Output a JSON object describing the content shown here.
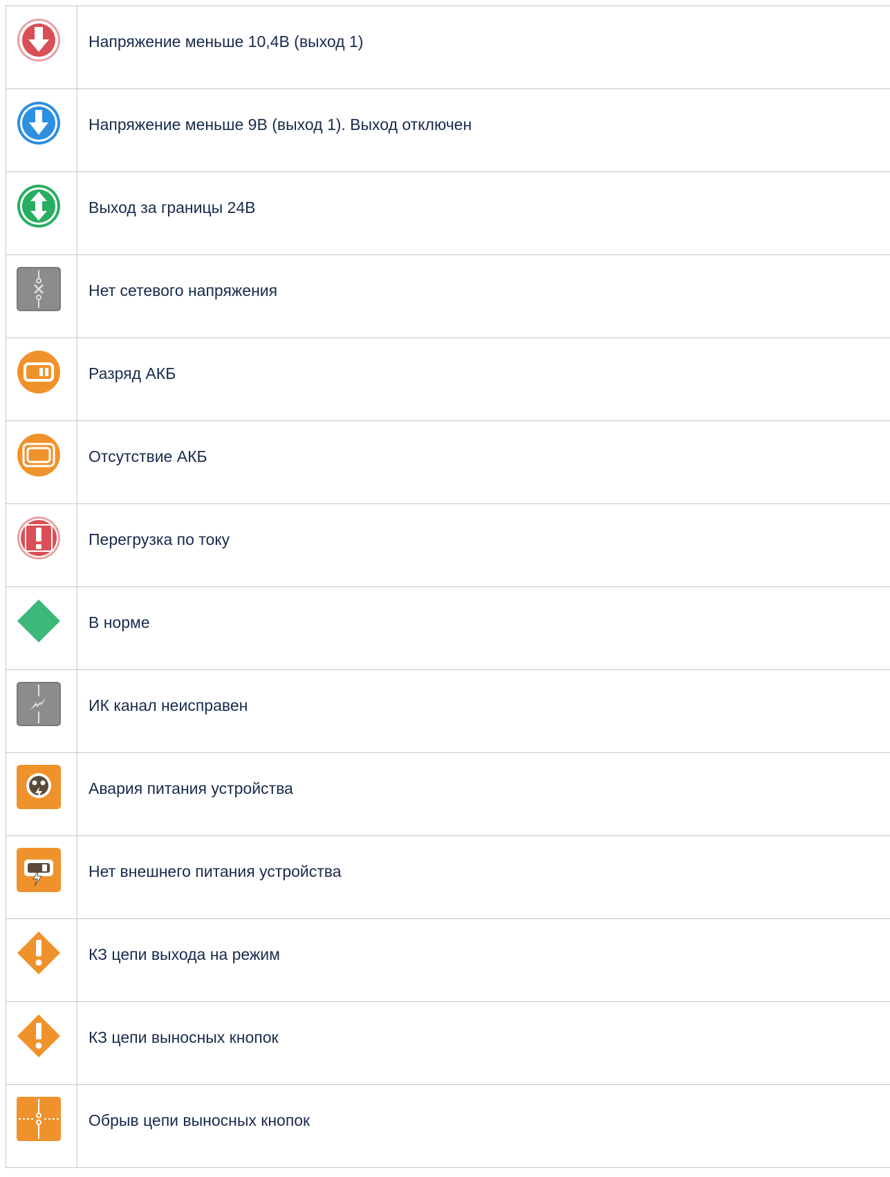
{
  "rows": [
    {
      "icon": "voltage-down-red-icon",
      "text": "Напряжение меньше 10,4В (выход 1)"
    },
    {
      "icon": "voltage-down-blue-icon",
      "text": "Напряжение меньше 9В (выход 1). Выход отключен"
    },
    {
      "icon": "voltage-out-of-range-icon",
      "text": "Выход за границы 24В"
    },
    {
      "icon": "no-mains-voltage-icon",
      "text": "Нет сетевого напряжения"
    },
    {
      "icon": "battery-discharged-icon",
      "text": "Разряд АКБ"
    },
    {
      "icon": "battery-missing-icon",
      "text": "Отсутствие АКБ"
    },
    {
      "icon": "current-overload-icon",
      "text": "Перегрузка по току"
    },
    {
      "icon": "normal-status-icon",
      "text": "В норме"
    },
    {
      "icon": "ir-channel-fault-icon",
      "text": "ИК канал неисправен"
    },
    {
      "icon": "device-power-failure-icon",
      "text": "Авария питания устройства"
    },
    {
      "icon": "no-external-power-icon",
      "text": "Нет внешнего питания устройства"
    },
    {
      "icon": "mode-circuit-short-icon",
      "text": "КЗ цепи выхода на режим"
    },
    {
      "icon": "remote-buttons-short-icon",
      "text": "КЗ цепи выносных кнопок"
    },
    {
      "icon": "remote-buttons-break-icon",
      "text": "Обрыв цепи выносных кнопок"
    }
  ],
  "colors": {
    "red": "#d94f55",
    "blue": "#2d8fe0",
    "green": "#27ae60",
    "grey": "#7a7a7a",
    "orange": "#f0922b",
    "text": "#172b4d",
    "border": "#c1c7d0"
  }
}
